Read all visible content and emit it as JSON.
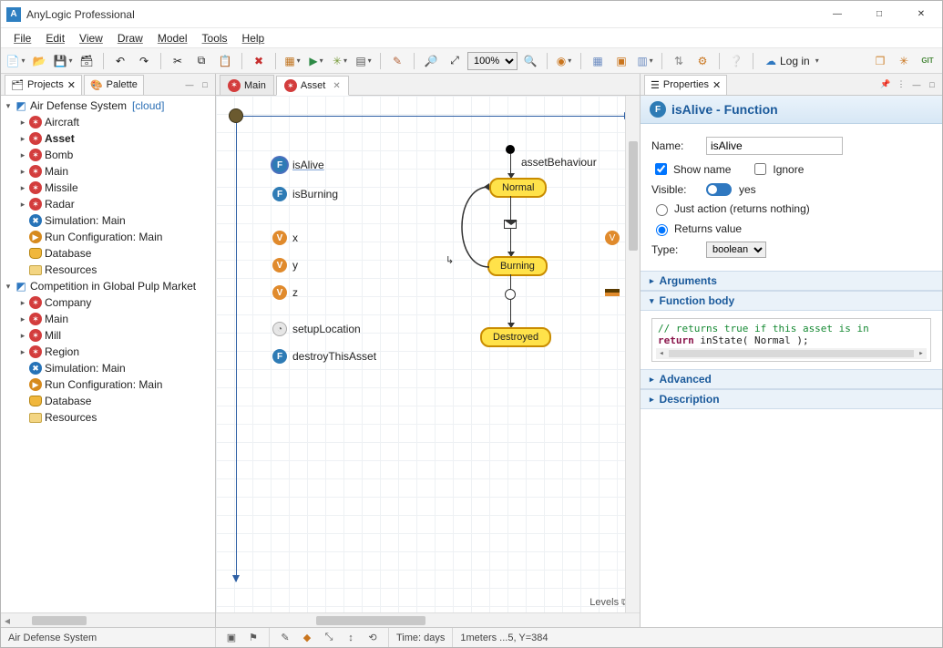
{
  "window": {
    "title": "AnyLogic Professional"
  },
  "menu": {
    "file": "File",
    "edit": "Edit",
    "view": "View",
    "draw": "Draw",
    "model": "Model",
    "tools": "Tools",
    "help": "Help"
  },
  "toolbar": {
    "zoom": "100%",
    "login": "Log in"
  },
  "leftTabs": {
    "projects": "Projects",
    "palette": "Palette"
  },
  "projects": {
    "root1": {
      "name": "Air Defense System",
      "tag": "[cloud]"
    },
    "root1items": [
      {
        "icon": "agent",
        "label": "Aircraft"
      },
      {
        "icon": "agent",
        "label": "Asset",
        "bold": true
      },
      {
        "icon": "agent",
        "label": "Bomb"
      },
      {
        "icon": "agent",
        "label": "Main"
      },
      {
        "icon": "agent",
        "label": "Missile"
      },
      {
        "icon": "agent",
        "label": "Radar"
      },
      {
        "icon": "exp",
        "label": "Simulation: Main"
      },
      {
        "icon": "run",
        "label": "Run Configuration: Main"
      },
      {
        "icon": "db",
        "label": "Database"
      },
      {
        "icon": "folder",
        "label": "Resources"
      }
    ],
    "root2": {
      "name": "Competition in Global Pulp Market"
    },
    "root2items": [
      {
        "icon": "agent",
        "label": "Company"
      },
      {
        "icon": "agent",
        "label": "Main"
      },
      {
        "icon": "agent",
        "label": "Mill"
      },
      {
        "icon": "agent",
        "label": "Region"
      },
      {
        "icon": "exp",
        "label": "Simulation: Main"
      },
      {
        "icon": "run",
        "label": "Run Configuration: Main"
      },
      {
        "icon": "db",
        "label": "Database"
      },
      {
        "icon": "folder",
        "label": "Resources"
      }
    ]
  },
  "editorTabs": {
    "t1": "Main",
    "t2": "Asset"
  },
  "canvas": {
    "isAlive": "isAlive",
    "isBurning": "isBurning",
    "x": "x",
    "y": "y",
    "z": "z",
    "setupLocation": "setupLocation",
    "destroyThisAsset": "destroyThisAsset",
    "assetBehaviour": "assetBehaviour",
    "stateNormal": "Normal",
    "stateBurning": "Burning",
    "stateDestroyed": "Destroyed",
    "levels": "Levels"
  },
  "props": {
    "tab": "Properties",
    "headerTitle": "isAlive - Function",
    "nameLabel": "Name:",
    "nameValue": "isAlive",
    "showName": "Show name",
    "ignore": "Ignore",
    "visibleLabel": "Visible:",
    "visibleYes": "yes",
    "radioJust": "Just action (returns nothing)",
    "radioReturns": "Returns value",
    "typeLabel": "Type:",
    "typeValue": "boolean",
    "secArguments": "Arguments",
    "secFunctionBody": "Function body",
    "codeComment": "// returns true if this asset is in",
    "codeLine": "return inState( Normal );",
    "codeKw": "return",
    "codeRest": " inState( Normal );",
    "secAdvanced": "Advanced",
    "secDescription": "Description"
  },
  "status": {
    "project": "Air Defense System",
    "time": "Time: days",
    "coords": "1meters ...5, Y=384"
  }
}
